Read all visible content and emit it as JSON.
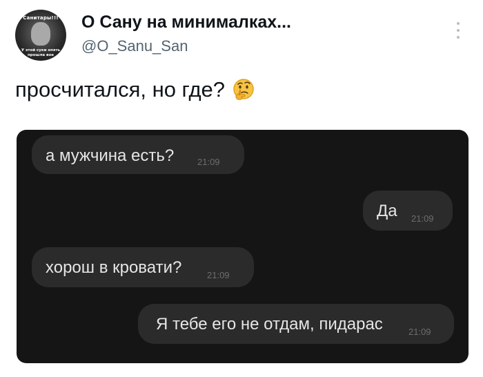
{
  "tweet": {
    "author": {
      "display_name": "О Сану на минималках...",
      "handle": "@O_Sanu_San",
      "avatar_text_top": "Санитары!!!",
      "avatar_text_bottom": "У этой суки опять\nпрошла вое"
    },
    "text": "просчитался, но где?",
    "emoji": "thinking-face-icon",
    "more_icon": "more-vertical-icon"
  },
  "chat": {
    "messages": [
      {
        "side": "left",
        "text": "а мужчина есть?",
        "time": "21:09"
      },
      {
        "side": "right",
        "text": "Да",
        "time": "21:09"
      },
      {
        "side": "left",
        "text": "хорош в кровати?",
        "time": "21:09"
      },
      {
        "side": "right",
        "text": "Я тебе его не отдам, пидарас",
        "time": "21:09"
      }
    ]
  },
  "colors": {
    "chat_background": "#151515",
    "bubble_background": "#2b2b2b",
    "bubble_text": "#e6e6e6",
    "timestamp_text": "#6d6d6d",
    "handle_text": "#536471",
    "primary_text": "#0f1419"
  }
}
